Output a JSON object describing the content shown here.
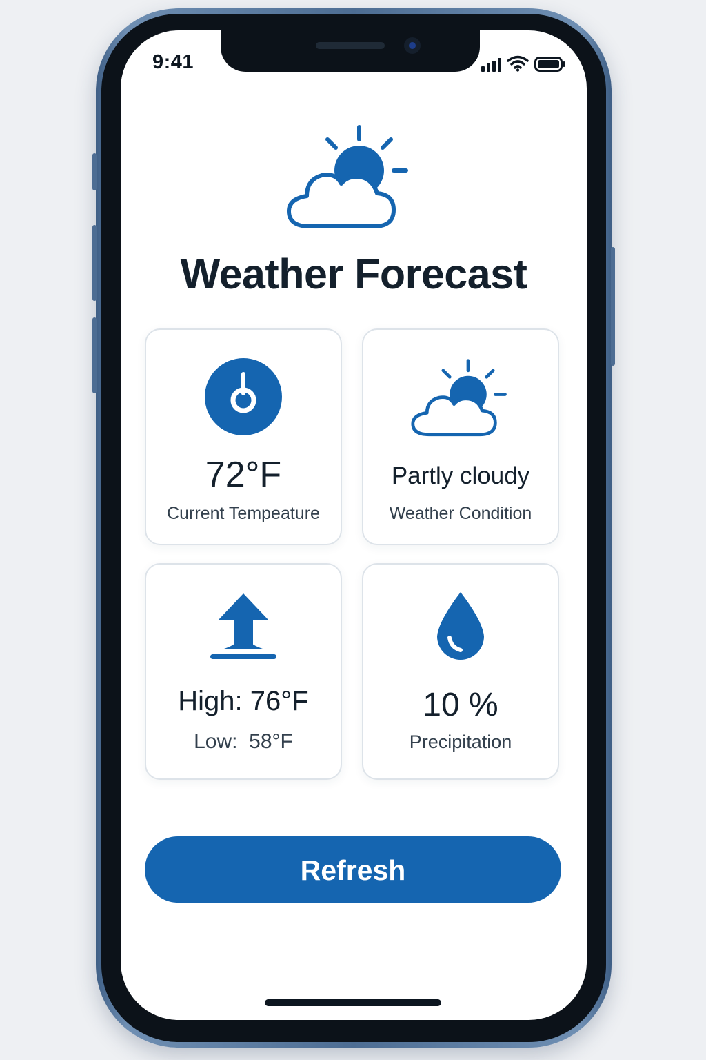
{
  "status_bar": {
    "time": "9:41",
    "icons": [
      "cellular-signal-icon",
      "wifi-icon",
      "battery-icon"
    ]
  },
  "header": {
    "icon": "partly-cloudy-icon",
    "title": "Weather Forecast"
  },
  "cards": [
    {
      "icon": "thermometer-icon",
      "value": "72°F",
      "label": "Current Tempeature"
    },
    {
      "icon": "partly-cloudy-icon",
      "value": "Partly cloudy",
      "label": "Weather Condition"
    },
    {
      "icon": "high-arrow-icon",
      "value": "High: 76°F",
      "label": "Low:  58°F"
    },
    {
      "icon": "raindrop-icon",
      "value": "10 %",
      "label": "Precipitation"
    }
  ],
  "actions": {
    "refresh_label": "Refresh"
  },
  "colors": {
    "accent": "#1565b0",
    "text_primary": "#14202c",
    "card_border": "#dde3e9"
  }
}
